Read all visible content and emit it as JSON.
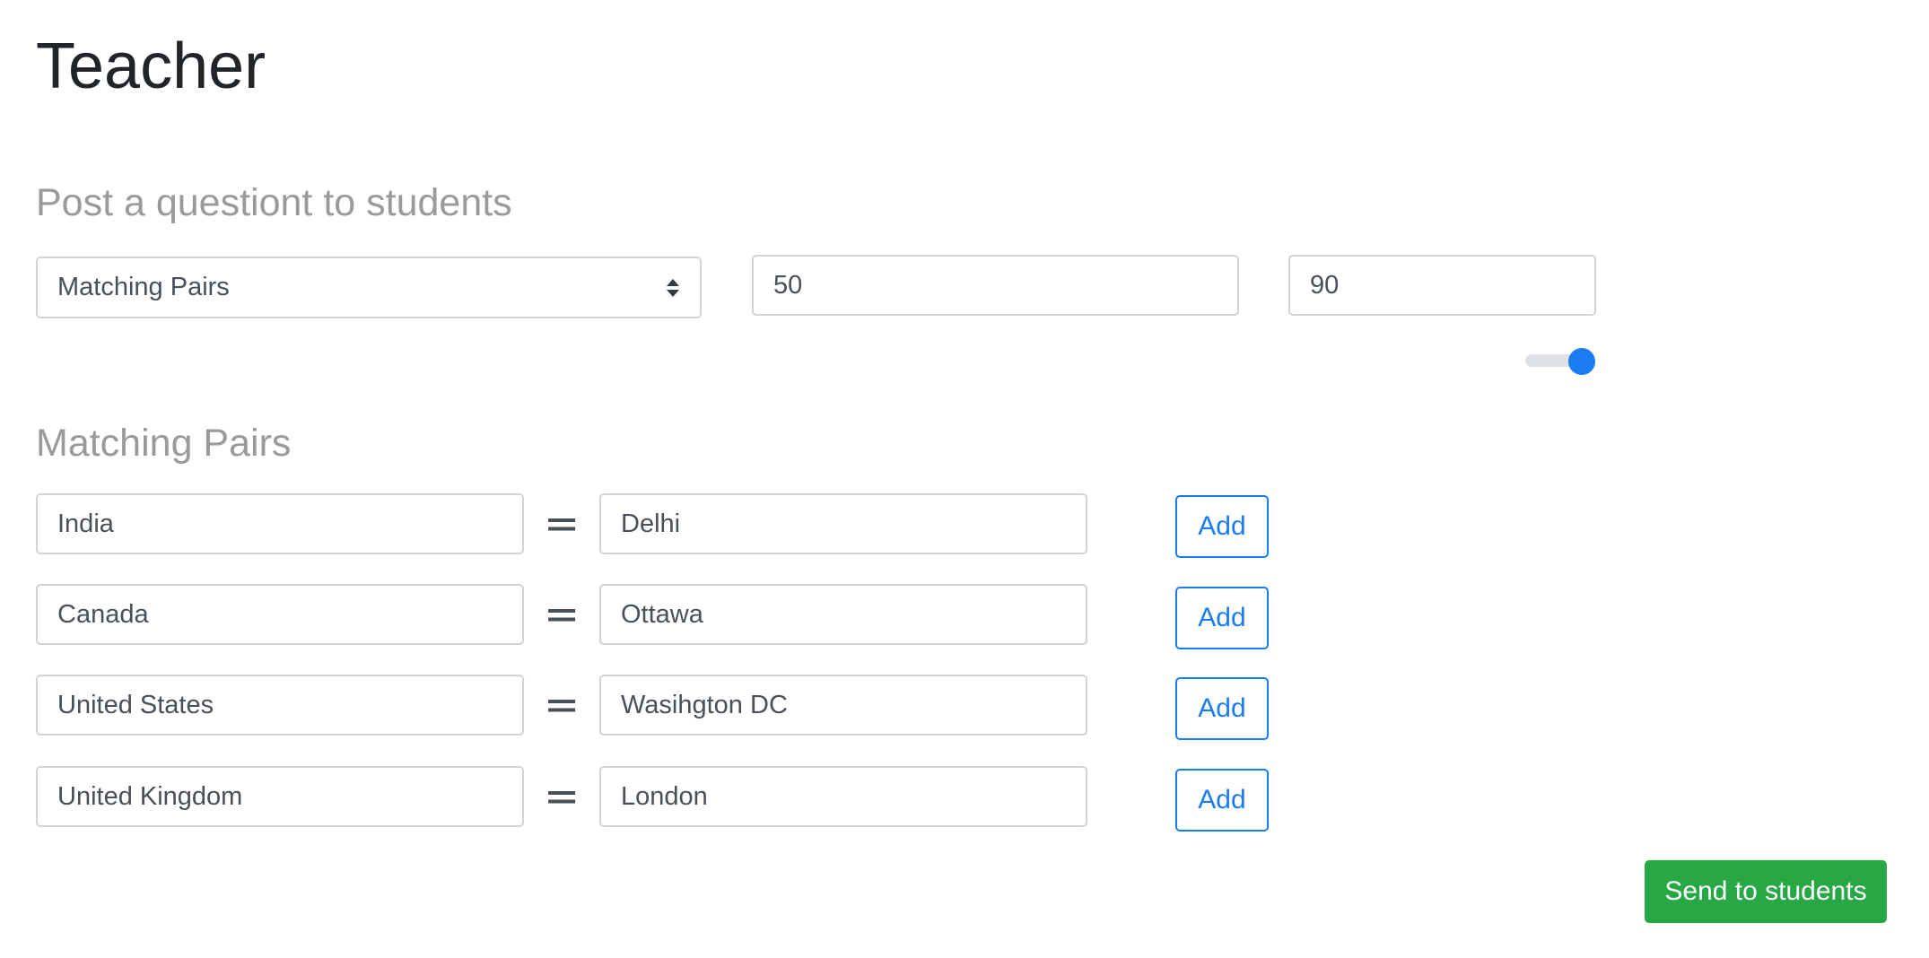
{
  "page": {
    "title": "Teacher"
  },
  "question": {
    "section_title": "Post a questiont to students",
    "type_select": {
      "selected": "Matching Pairs"
    },
    "field_one_value": "50",
    "field_two_value": "90",
    "toggle_on": true
  },
  "pairs": {
    "section_title": "Matching Pairs",
    "separator": "=",
    "add_label": "Add",
    "rows": [
      {
        "left": "India",
        "right": "Delhi"
      },
      {
        "left": "Canada",
        "right": "Ottawa"
      },
      {
        "left": "United States",
        "right": "Wasihgton DC"
      },
      {
        "left": "United Kingdom",
        "right": "London"
      }
    ]
  },
  "actions": {
    "send_label": "Send to students"
  },
  "colors": {
    "primary": "#1a7cf0",
    "success": "#28a745",
    "muted_heading": "#9a9a9a",
    "border": "#ced4da"
  },
  "icons": {
    "select_caret": "sort-caret-icon"
  }
}
